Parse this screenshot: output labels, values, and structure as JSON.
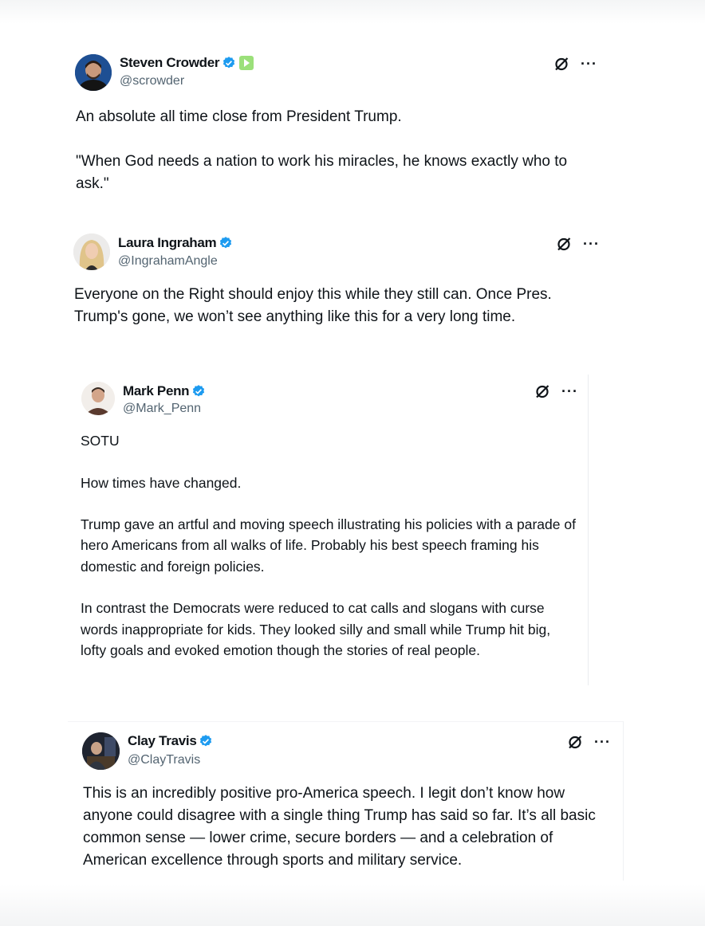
{
  "tweets": [
    {
      "name": "Steven Crowder",
      "handle": "@scrowder",
      "text": "An absolute all time close from President Trump.\n\n\"When God needs a nation to work his miracles, he knows exactly who to ask.\"",
      "badges": [
        "verified-icon",
        "video-badge-icon"
      ],
      "more": "···"
    },
    {
      "name": "Laura Ingraham",
      "handle": "@IngrahamAngle",
      "text": "Everyone on the Right should enjoy this while they still can.  Once Pres. Trump's gone, we won’t see anything like this for a very long time.",
      "badges": [
        "verified-icon"
      ],
      "more": "···"
    },
    {
      "name": "Mark Penn",
      "handle": "@Mark_Penn",
      "text": "SOTU\n\nHow times have changed.\n\nTrump gave an artful and moving speech illustrating his policies with a parade of hero Americans from all walks of life. Probably his best speech framing his domestic and foreign policies.\n\nIn contrast the Democrats were reduced to cat calls and slogans with curse words inappropriate for kids. They looked silly and small while Trump hit big, lofty goals and evoked emotion though the stories of real people.",
      "badges": [
        "verified-icon"
      ],
      "more": "···"
    },
    {
      "name": "Clay Travis",
      "handle": "@ClayTravis",
      "text": "This is an incredibly positive pro-America speech. I legit don’t know how anyone could disagree with a single thing Trump has said so far. It’s all basic common sense — lower crime, secure borders — and a celebration of American excellence through sports and military service.",
      "badges": [
        "verified-icon"
      ],
      "more": "···"
    }
  ],
  "colors": {
    "verified": "#1d9bf0",
    "handle": "#536471",
    "text": "#0f1419"
  }
}
